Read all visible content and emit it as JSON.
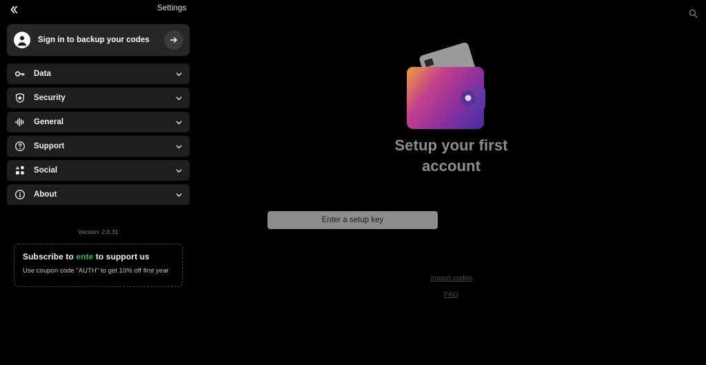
{
  "header": {
    "collapse_icon": "chevron-double-left-icon",
    "title": "Settings",
    "search_icon": "search-icon"
  },
  "sidebar": {
    "signin": {
      "label": "Sign in to backup your codes",
      "avatar_icon": "person-avatar-icon",
      "arrow_icon": "arrow-right-icon"
    },
    "items": [
      {
        "label": "Data",
        "icon": "key-icon",
        "chevron": "chevron-down-icon"
      },
      {
        "label": "Security",
        "icon": "shield-star-icon",
        "chevron": "chevron-down-icon"
      },
      {
        "label": "General",
        "icon": "audio-waveform-icon",
        "chevron": "chevron-down-icon"
      },
      {
        "label": "Support",
        "icon": "question-circle-icon",
        "chevron": "chevron-down-icon"
      },
      {
        "label": "Social",
        "icon": "shapes-category-icon",
        "chevron": "chevron-down-icon"
      },
      {
        "label": "About",
        "icon": "info-circle-icon",
        "chevron": "chevron-down-icon"
      }
    ],
    "version": "Version: 2.0.31",
    "subscribe": {
      "title_prefix": "Subscribe to ",
      "brand": "ente",
      "title_suffix": " to support us",
      "subtitle": "Use coupon code \"AUTH\" to get 10% off first year"
    }
  },
  "main": {
    "illustration": "wallet-with-card-icon",
    "headline_line1": "Setup your first",
    "headline_line2": "account",
    "setup_button": "Enter a setup key",
    "import_link": "Import codes",
    "faq_link": "FAQ"
  },
  "colors": {
    "background": "#000000",
    "card": "#262626",
    "row": "#1e1e1e",
    "brand_green": "#1db954",
    "button_gray": "#8d8d8d",
    "headline_gray": "#8e8e8e",
    "wallet_gradient_start": "#e8912f",
    "wallet_gradient_mid": "#b5318c",
    "wallet_gradient_end": "#3b31a8"
  }
}
